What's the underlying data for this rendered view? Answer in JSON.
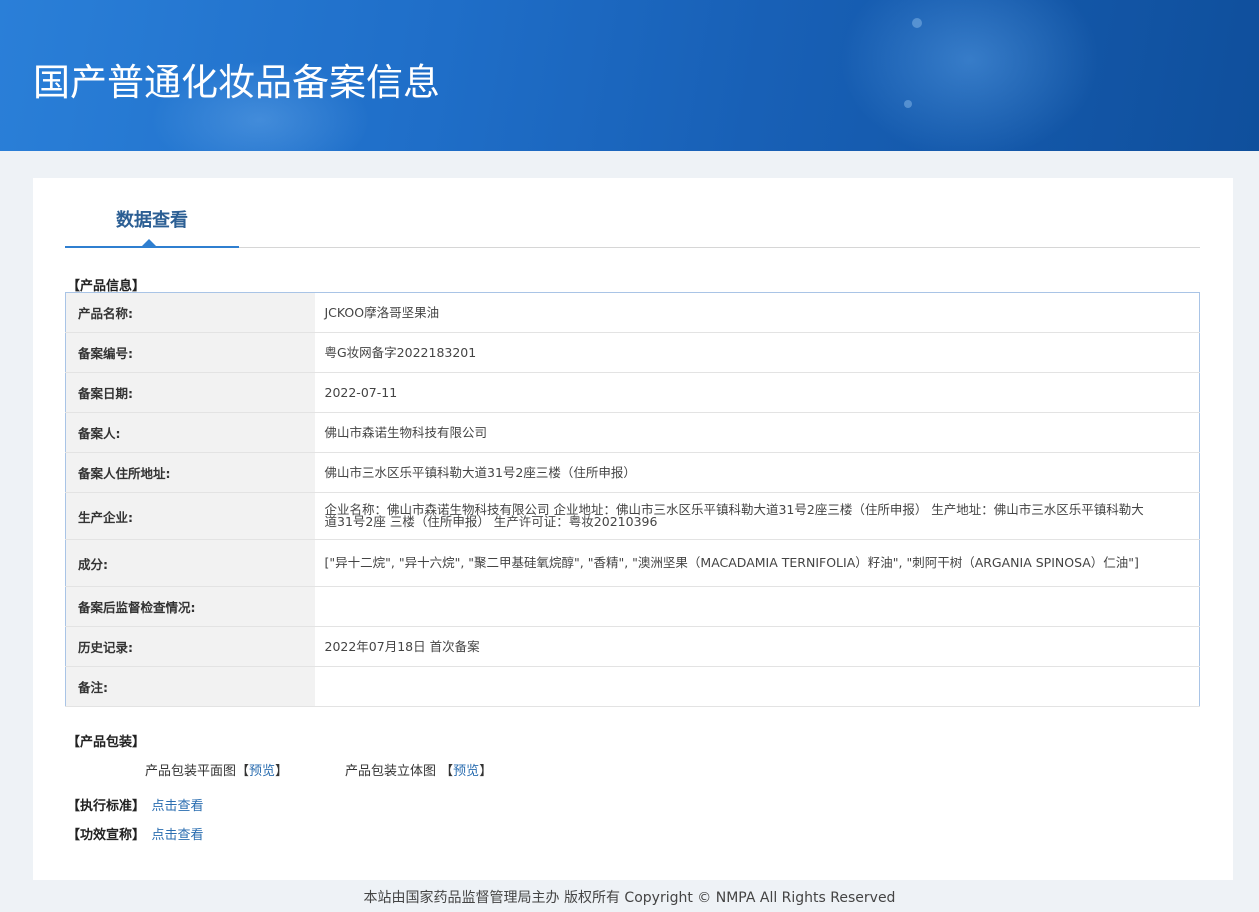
{
  "banner": {
    "title": "国产普通化妆品备案信息"
  },
  "tab": {
    "label": "数据查看"
  },
  "sections": {
    "product_info": "【产品信息】",
    "packaging": "【产品包装】",
    "standard": "【执行标准】",
    "efficacy": "【功效宣称】"
  },
  "product_rows": [
    {
      "label": "产品名称:",
      "value": "JCKOO摩洛哥坚果油"
    },
    {
      "label": "备案编号:",
      "value": "粤G妆网备字2022183201"
    },
    {
      "label": "备案日期:",
      "value": "2022-07-11"
    },
    {
      "label": "备案人:",
      "value": "佛山市森诺生物科技有限公司"
    },
    {
      "label": "备案人住所地址:",
      "value": "佛山市三水区乐平镇科勒大道31号2座三楼（住所申报）"
    },
    {
      "label": "生产企业:",
      "value": "企业名称：佛山市森诺生物科技有限公司 企业地址：佛山市三水区乐平镇科勒大道31号2座三楼（住所申报） 生产地址：佛山市三水区乐平镇科勒大道31号2座 三楼（住所申报） 生产许可证：粤妆20210396"
    },
    {
      "label": "成分:",
      "value": "[\"异十二烷\", \"异十六烷\", \"聚二甲基硅氧烷醇\", \"香精\", \"澳洲坚果（MACADAMIA TERNIFOLIA）籽油\", \"刺阿干树（ARGANIA SPINOSA）仁油\"]"
    },
    {
      "label": "备案后监督检查情况:",
      "value": ""
    },
    {
      "label": "历史记录:",
      "value": "2022年07月18日 首次备案"
    },
    {
      "label": "备注:",
      "value": ""
    }
  ],
  "packaging": {
    "flat_label": "产品包装平面图",
    "stereo_label": "产品包装立体图",
    "preview_text": "预览",
    "bracket_open": "【",
    "bracket_close": "】"
  },
  "links": {
    "view": "点击查看"
  },
  "footer": {
    "text": "本站由国家药品监督管理局主办 版权所有 Copyright © NMPA All Rights Reserved"
  }
}
